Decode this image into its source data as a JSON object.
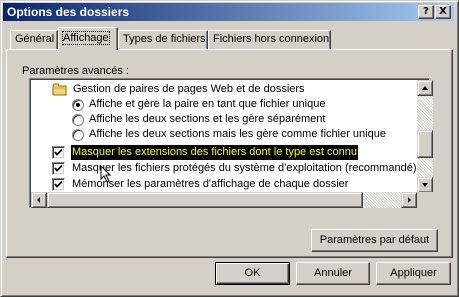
{
  "window": {
    "title": "Options des dossiers",
    "help_label": "?",
    "close_label": "X"
  },
  "tabs": [
    {
      "label": "Général",
      "active": false
    },
    {
      "label": "Affichage",
      "active": true
    },
    {
      "label": "Types de fichiers",
      "active": false
    },
    {
      "label": "Fichiers hors connexion",
      "active": false
    }
  ],
  "advanced": {
    "label": "Paramètres avancés :",
    "items": [
      {
        "kind": "folder",
        "text": "Gestion de paires de pages Web et de dossiers"
      },
      {
        "kind": "radio",
        "checked": true,
        "text": "Affiche et gère la paire en tant que fichier unique"
      },
      {
        "kind": "radio",
        "checked": false,
        "text": "Affiche les deux sections et les gère séparément"
      },
      {
        "kind": "radio",
        "checked": false,
        "text": "Affiche les deux sections mais les gère comme fichier unique"
      },
      {
        "kind": "checkbox",
        "checked": true,
        "selected": true,
        "text": "Masquer les extensions des fichiers dont le type est connu"
      },
      {
        "kind": "checkbox",
        "checked": true,
        "text": "Masquer les fichiers protégés du système d'exploitation (recommandé)"
      },
      {
        "kind": "checkbox",
        "checked": true,
        "text": "Mémoriser les paramètres d'affichage de chaque dossier"
      }
    ]
  },
  "buttons": {
    "defaults": "Paramètres par défaut",
    "ok": "OK",
    "cancel": "Annuler",
    "apply": "Appliquer"
  },
  "colors": {
    "title_start": "#0a246a",
    "title_end": "#a6caf0",
    "selection_bg": "#000000",
    "selection_fg": "#ffff00"
  }
}
